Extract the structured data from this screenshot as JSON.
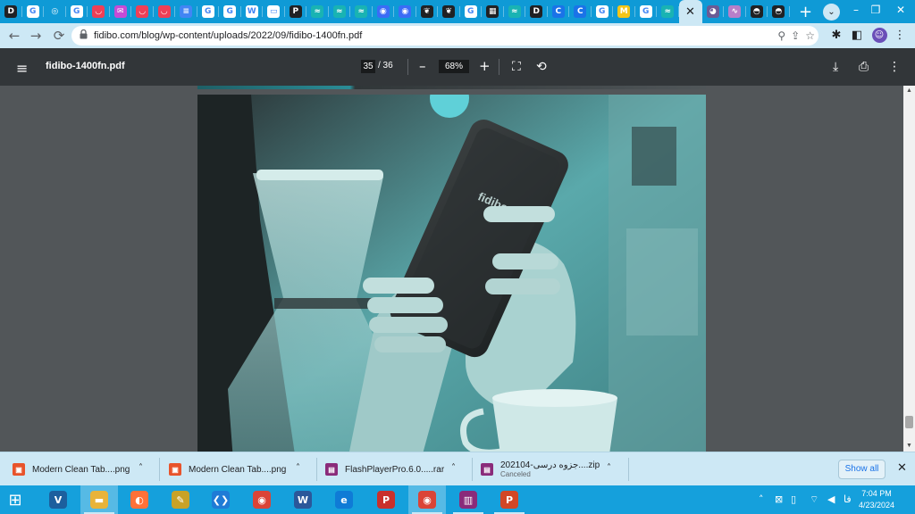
{
  "tabs": [
    {
      "icon": "docs-icon",
      "glyph": "D",
      "color": "#202124"
    },
    {
      "icon": "google-icon",
      "glyph": "G",
      "color": "#ffffff"
    },
    {
      "icon": "circle-app-icon",
      "glyph": "◎",
      "color": "#0f9ad6"
    },
    {
      "icon": "google-icon",
      "glyph": "G",
      "color": "#ffffff"
    },
    {
      "icon": "pocket-icon",
      "glyph": "◡",
      "color": "#ef3f56"
    },
    {
      "icon": "mail-icon",
      "glyph": "✉",
      "color": "#c54bd6"
    },
    {
      "icon": "pocket-icon",
      "glyph": "◡",
      "color": "#ef3f56"
    },
    {
      "icon": "pocket-icon",
      "glyph": "◡",
      "color": "#ef3f56"
    },
    {
      "icon": "google-docs-icon",
      "glyph": "≡",
      "color": "#4285f4"
    },
    {
      "icon": "google-icon",
      "glyph": "G",
      "color": "#ffffff"
    },
    {
      "icon": "google-icon",
      "glyph": "G",
      "color": "#ffffff"
    },
    {
      "icon": "wikipedia-icon",
      "glyph": "W",
      "color": "#ffffff"
    },
    {
      "icon": "window-icon",
      "glyph": "▭",
      "color": "#ffffff"
    },
    {
      "icon": "p-app-icon",
      "glyph": "P",
      "color": "#202124"
    },
    {
      "icon": "wave-icon",
      "glyph": "≈",
      "color": "#19b3b3"
    },
    {
      "icon": "wave-icon",
      "glyph": "≈",
      "color": "#19b3b3"
    },
    {
      "icon": "wave-icon",
      "glyph": "≈",
      "color": "#19b3b3"
    },
    {
      "icon": "messenger-icon",
      "glyph": "◉",
      "color": "#3b6cf6"
    },
    {
      "icon": "messenger-icon",
      "glyph": "◉",
      "color": "#3b6cf6"
    },
    {
      "icon": "feather-icon",
      "glyph": "❦",
      "color": "#202124"
    },
    {
      "icon": "feather-icon",
      "glyph": "❦",
      "color": "#202124"
    },
    {
      "icon": "google-icon",
      "glyph": "G",
      "color": "#ffffff"
    },
    {
      "icon": "qr-icon",
      "glyph": "▦",
      "color": "#202124"
    },
    {
      "icon": "wave-icon",
      "glyph": "≈",
      "color": "#19b3b3"
    },
    {
      "icon": "docs-icon",
      "glyph": "D",
      "color": "#202124"
    },
    {
      "icon": "c-app-icon",
      "glyph": "C",
      "color": "#1a73e8"
    },
    {
      "icon": "c-app-icon",
      "glyph": "C",
      "color": "#1a73e8"
    },
    {
      "icon": "google-icon",
      "glyph": "G",
      "color": "#ffffff"
    },
    {
      "icon": "yellow-app-icon",
      "glyph": "M",
      "color": "#f5c518"
    },
    {
      "icon": "google-icon",
      "glyph": "G",
      "color": "#ffffff"
    },
    {
      "icon": "wave-icon",
      "glyph": "≈",
      "color": "#19b3b3"
    }
  ],
  "tabs_after": [
    {
      "icon": "owl-icon",
      "glyph": "◕",
      "color": "#6b5b95"
    },
    {
      "icon": "swirl-icon",
      "glyph": "∿",
      "color": "#b77fc9"
    },
    {
      "icon": "mask-icon",
      "glyph": "◓",
      "color": "#202124"
    },
    {
      "icon": "mask-icon",
      "glyph": "◓",
      "color": "#202124"
    }
  ],
  "active_tab": {
    "close_glyph": "✕"
  },
  "newtab_glyph": "+",
  "window": {
    "minimize": "–",
    "restore": "❐",
    "close": "✕"
  },
  "address": {
    "url": "fidibo.com/blog/wp-content/uploads/2022/09/fidibo-1400fn.pdf",
    "lock_glyph": "🔒",
    "back": "←",
    "forward": "→",
    "reload": "⟳"
  },
  "pdf": {
    "title": "fidibo-1400fn.pdf",
    "current_page": "35",
    "total_pages": "/ 36",
    "zoom": "68%",
    "zoom_out": "–",
    "zoom_in": "+",
    "menu_glyph": "≡",
    "fit_glyph": "⛶",
    "rotate_glyph": "⟲",
    "download_glyph": "⤓",
    "print_glyph": "⎙",
    "more_glyph": "⋮"
  },
  "device_logo": "fidibo",
  "downloads": [
    {
      "name": "Modern Clean Tab....png",
      "icon": "png-file-icon",
      "color": "#e8532b",
      "glyph": "▣"
    },
    {
      "name": "Modern Clean Tab....png",
      "icon": "png-file-icon",
      "color": "#e8532b",
      "glyph": "▣"
    },
    {
      "name": "FlashPlayerPro.6.0.....rar",
      "icon": "rar-file-icon",
      "color": "#8a2b7a",
      "glyph": "▤"
    },
    {
      "name": "202104-جزوه درسی....zip",
      "status": "Canceled",
      "icon": "zip-file-icon",
      "color": "#8a2b7a",
      "glyph": "▤"
    }
  ],
  "show_all": "Show all",
  "downloads_close": "✕",
  "taskbar": {
    "apps": [
      {
        "name": "windows-start-icon",
        "glyph": "⊞",
        "bg": "transparent"
      },
      {
        "name": "v-app-icon",
        "glyph": "V",
        "bg": "#1c5f9e"
      },
      {
        "name": "file-explorer-icon",
        "glyph": "▬",
        "bg": "#e8b33a"
      },
      {
        "name": "firefox-icon",
        "glyph": "◐",
        "bg": "#ff7139"
      },
      {
        "name": "tools-app-icon",
        "glyph": "✎",
        "bg": "#c9a227"
      },
      {
        "name": "vscode-icon",
        "glyph": "❮❯",
        "bg": "#1f7bd6"
      },
      {
        "name": "chrome-icon",
        "glyph": "◉",
        "bg": "#db4437"
      },
      {
        "name": "word-icon",
        "glyph": "W",
        "bg": "#2b579a"
      },
      {
        "name": "edge-icon",
        "glyph": "e",
        "bg": "#0f7bd6"
      },
      {
        "name": "psiphon-icon",
        "glyph": "P",
        "bg": "#c9302c"
      },
      {
        "name": "chrome-profile-icon",
        "glyph": "◉",
        "bg": "#db4437"
      },
      {
        "name": "winrar-icon",
        "glyph": "▥",
        "bg": "#8a2b7a"
      },
      {
        "name": "powerpoint-icon",
        "glyph": "P",
        "bg": "#d24726"
      }
    ],
    "tray": {
      "chevron": "˄",
      "lang": "فا",
      "time": "7:04 PM",
      "date": "4/23/2024"
    }
  }
}
